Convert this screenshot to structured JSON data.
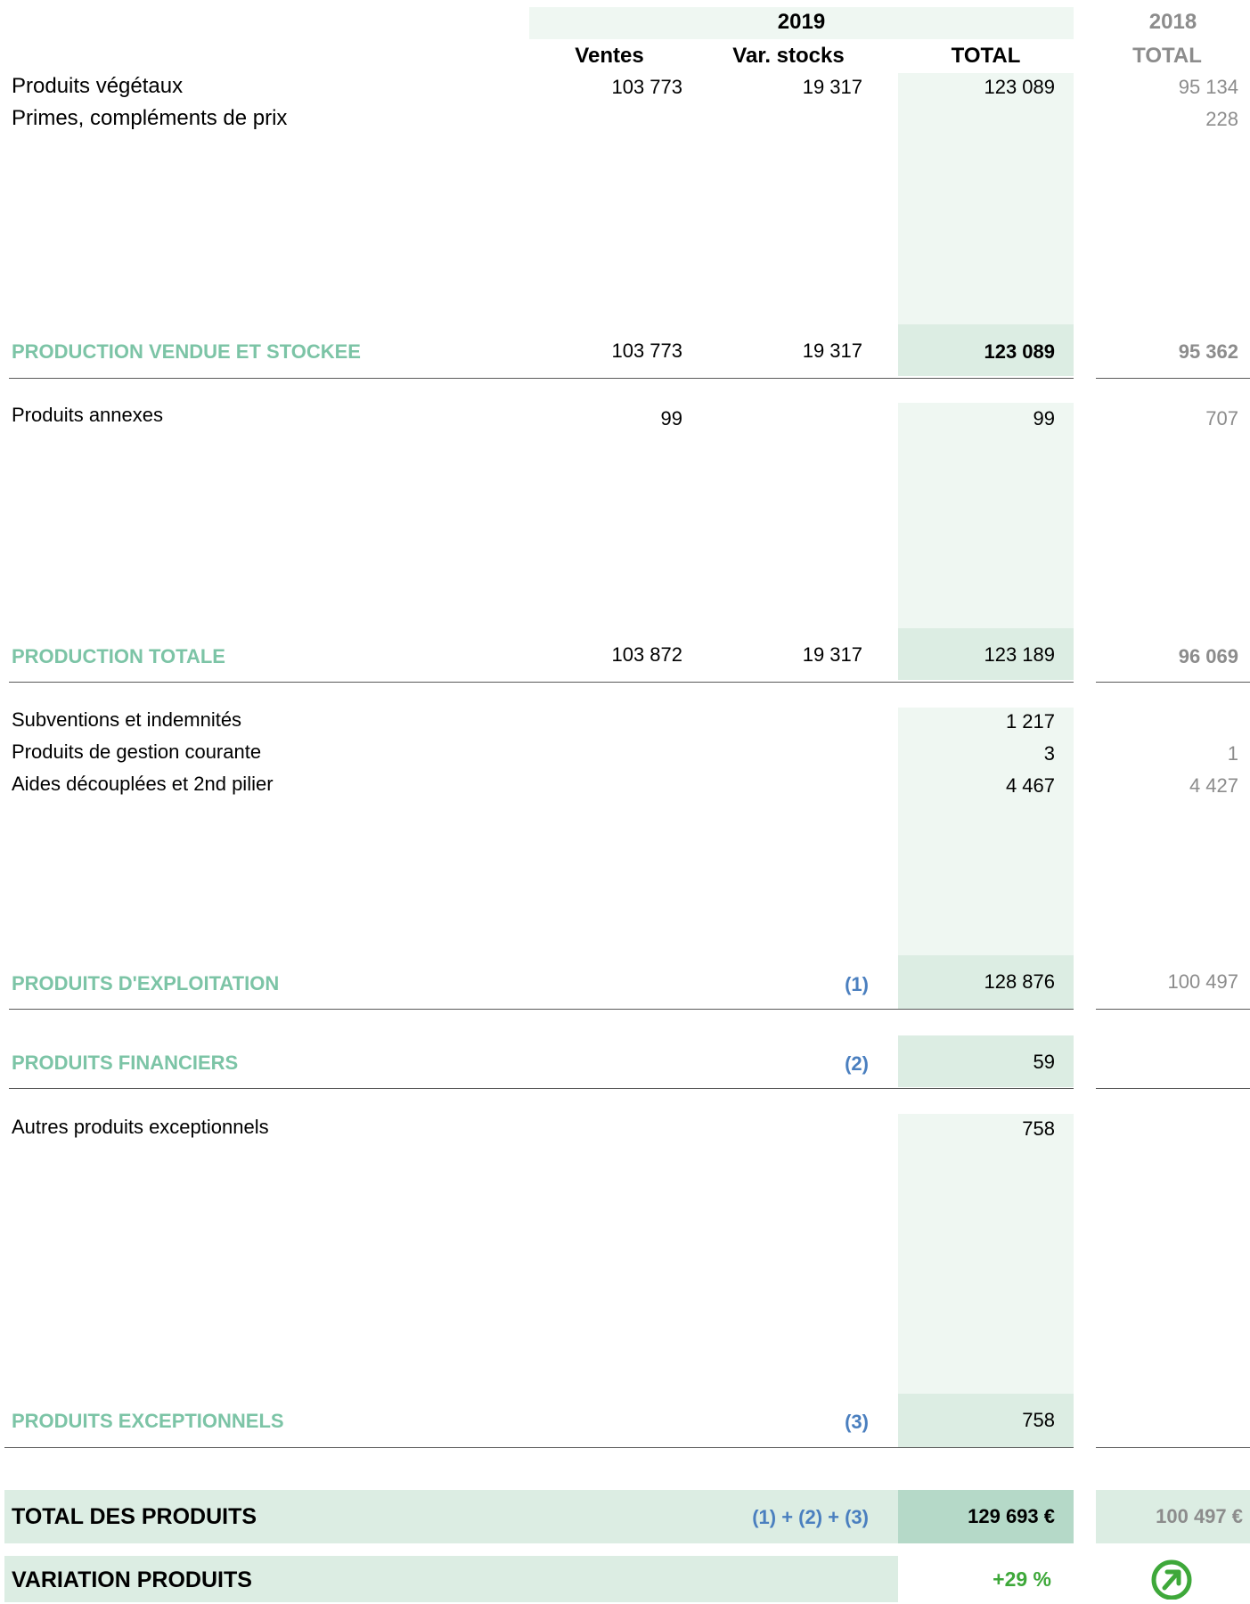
{
  "header": {
    "year_current": "2019",
    "year_previous": "2018",
    "col_ventes": "Ventes",
    "col_var_stocks": "Var.  stocks",
    "col_total": "TOTAL",
    "col_total_prev": "TOTAL"
  },
  "rows": {
    "vegetaux": {
      "label": "Produits végétaux",
      "ventes": "103 773",
      "var": "19 317",
      "total": "123 089",
      "prev": "95 134"
    },
    "primes": {
      "label": "Primes, compléments de prix",
      "prev": "228"
    },
    "prod_vendue": {
      "label": "PRODUCTION VENDUE ET STOCKEE",
      "ventes": "103 773",
      "var": "19 317",
      "total": "123 089",
      "prev": "95 362"
    },
    "annexes": {
      "label": "Produits annexes",
      "ventes": "99",
      "total": "99",
      "prev": "707"
    },
    "prod_totale": {
      "label": "PRODUCTION TOTALE",
      "ventes": "103 872",
      "var": "19 317",
      "total": "123 189",
      "prev": "96 069"
    },
    "subventions": {
      "label": "Subventions et indemnités",
      "total": "1 217"
    },
    "gestion": {
      "label": "Produits de gestion courante",
      "total": "3",
      "prev": "1"
    },
    "aides": {
      "label": "Aides découplées et 2nd pilier",
      "total": "4 467",
      "prev": "4 427"
    },
    "exploitation": {
      "label": "PRODUITS D'EXPLOITATION",
      "ref": "(1)",
      "total": "128 876",
      "prev": "100 497"
    },
    "financiers": {
      "label": "PRODUITS FINANCIERS",
      "ref": "(2)",
      "total": "59"
    },
    "autres_exc": {
      "label": "Autres produits exceptionnels",
      "total": "758"
    },
    "exceptionnels": {
      "label": "PRODUITS EXCEPTIONNELS",
      "ref": "(3)",
      "total": "758"
    }
  },
  "totals": {
    "label": "TOTAL DES PRODUITS",
    "formula": "(1) + (2) + (3)",
    "value": "129 693 €",
    "prev": "100 497 €"
  },
  "variation": {
    "label": "VARIATION PRODUITS",
    "value": "+29 %",
    "icon": "up-right-arrow-icon",
    "color": "#3ea83a"
  },
  "colors": {
    "section": "#7cc4a6",
    "ref": "#4a7fbf",
    "highlight_light": "#eff7f2",
    "highlight_mid": "#dcede3",
    "highlight_dark": "#b5d9c8"
  }
}
